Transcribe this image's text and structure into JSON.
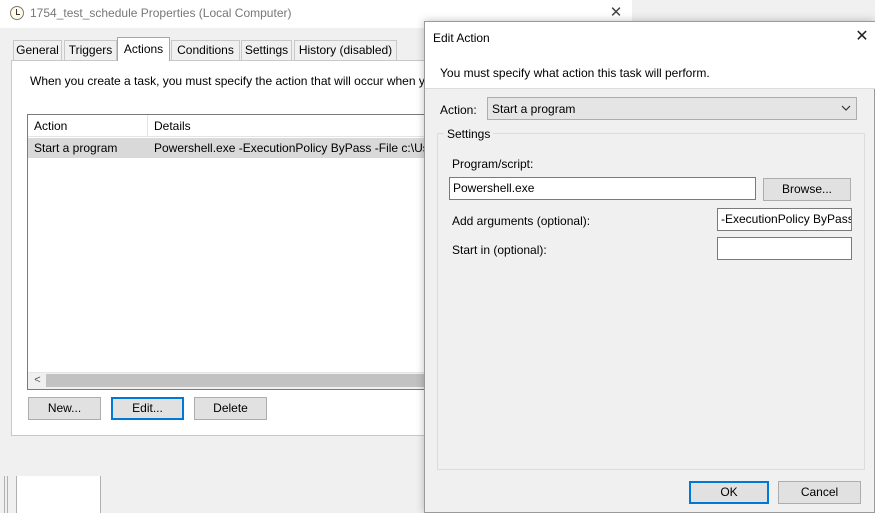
{
  "background_window": {
    "title": "1754_test_schedule Properties (Local Computer)",
    "tabs": [
      {
        "label": "General"
      },
      {
        "label": "Triggers"
      },
      {
        "label": "Actions"
      },
      {
        "label": "Conditions"
      },
      {
        "label": "Settings"
      },
      {
        "label": "History (disabled)"
      }
    ],
    "active_tab": "Actions",
    "intro_text": "When you create a task, you must specify the action that will occur when y",
    "table": {
      "columns": [
        "Action",
        "Details"
      ],
      "rows": [
        {
          "action": "Start a program",
          "details": "Powershell.exe -ExecutionPolicy ByPass -File c:\\Use"
        }
      ]
    },
    "buttons": {
      "new": "New...",
      "edit": "Edit...",
      "delete": "Delete"
    }
  },
  "dialog": {
    "title": "Edit Action",
    "message": "You must specify what action this task will perform.",
    "action_label": "Action:",
    "action_value": "Start a program",
    "settings_group_label": "Settings",
    "program_label": "Program/script:",
    "program_value": "Powershell.exe",
    "browse_label": "Browse...",
    "arguments_label": "Add arguments (optional):",
    "arguments_value": "-ExecutionPolicy ByPass",
    "start_in_label": "Start in (optional):",
    "start_in_value": "",
    "ok_label": "OK",
    "cancel_label": "Cancel"
  },
  "icons": {
    "title_icon": "clock-icon",
    "close_icon": "close-icon",
    "dropdown_icon": "chevron-down-icon",
    "scroll_left_icon": "scroll-left-arrow-icon"
  },
  "colors": {
    "focus_border": "#0078d7",
    "selected_row": "#d9d9d9",
    "window_bg": "#f0f0f0"
  }
}
